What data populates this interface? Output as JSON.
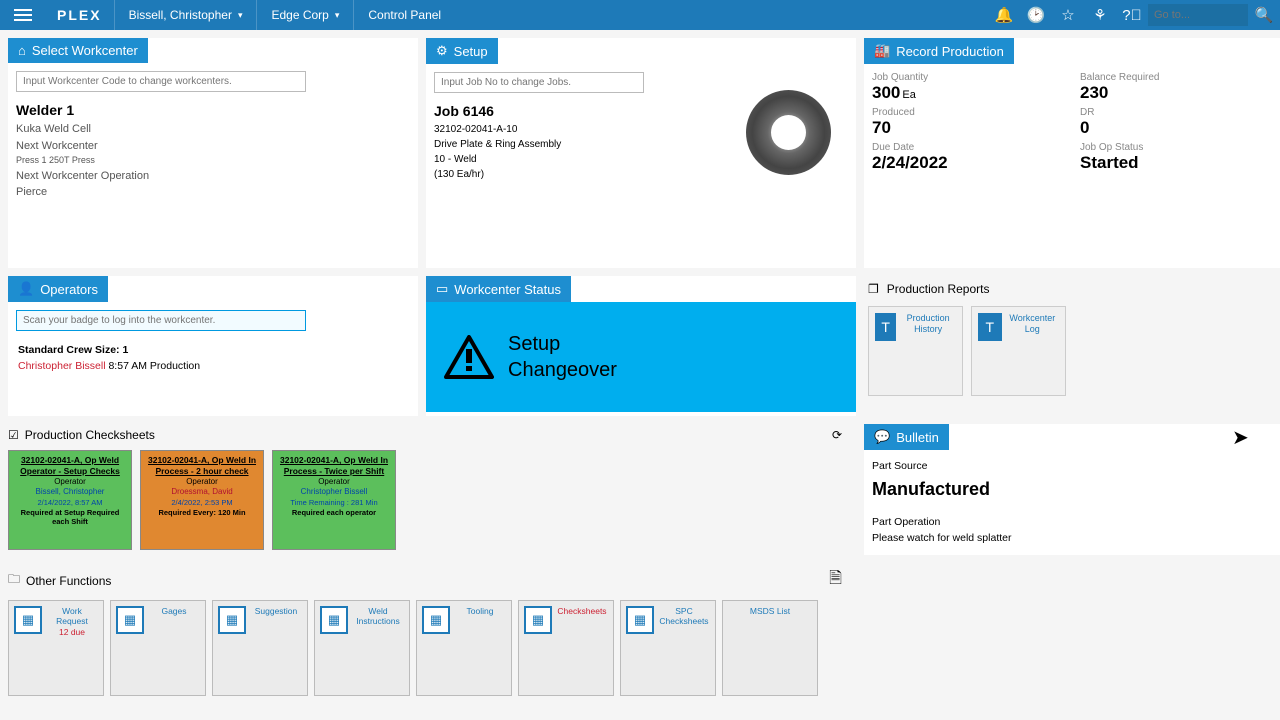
{
  "topbar": {
    "logo": "PLEX",
    "user": "Bissell, Christopher",
    "company": "Edge Corp",
    "page": "Control Panel",
    "goto_placeholder": "Go to..."
  },
  "workcenter": {
    "header": "Select Workcenter",
    "input_placeholder": "Input Workcenter Code to change workcenters.",
    "name": "Welder 1",
    "cell": "Kuka Weld Cell",
    "next_label": "Next Workcenter",
    "next_value": "Press 1 250T Press",
    "next_op_label": "Next Workcenter Operation",
    "next_op_value": "Pierce"
  },
  "setup": {
    "header": "Setup",
    "input_placeholder": "Input Job No to change Jobs.",
    "job_title": "Job 6146",
    "part_no": "32102-02041-A-10",
    "part_name": "Drive Plate & Ring Assembly",
    "op": "10 - Weld",
    "rate": "(130 Ea/hr)"
  },
  "production": {
    "header": "Record Production",
    "labels": {
      "qty": "Job Quantity",
      "balance": "Balance Required",
      "produced": "Produced",
      "dr": "DR",
      "due": "Due Date",
      "status": "Job Op Status"
    },
    "values": {
      "qty": "300",
      "qty_unit": "Ea",
      "balance": "230",
      "produced": "70",
      "dr": "0",
      "due": "2/24/2022",
      "status": "Started"
    }
  },
  "operators": {
    "header": "Operators",
    "input_placeholder": "Scan your badge to log into the workcenter.",
    "crew": "Standard Crew Size: 1",
    "name": "Christopher Bissell",
    "time": "8:57 AM Production"
  },
  "status": {
    "header": "Workcenter Status",
    "line1": "Setup",
    "line2": "Changeover"
  },
  "reports": {
    "header": "Production Reports",
    "tiles": [
      "Production History",
      "Workcenter Log"
    ]
  },
  "checksheets": {
    "header": "Production Checksheets",
    "items": [
      {
        "color": "cs-green",
        "title": "32102-02041-A, Op Weld Operator - Setup Checks",
        "role": "Operator",
        "name": "Bissell, Christopher",
        "time": "2/14/2022, 8:57 AM",
        "req": "Required at Setup Required each Shift"
      },
      {
        "color": "cs-orange",
        "title": "32102-02041-A, Op Weld In Process - 2 hour check",
        "role": "Operator",
        "name": "Droessma, David",
        "time": "2/4/2022, 2:53 PM",
        "req": "Required Every: 120 Min"
      },
      {
        "color": "cs-green",
        "title": "32102-02041-A, Op Weld In Process - Twice per Shift",
        "role": "Operator",
        "name": "Christopher Bissell",
        "time": "Time Remaining : 281 Min",
        "req": "Required each operator"
      }
    ]
  },
  "bulletin": {
    "header": "Bulletin",
    "source_label": "Part Source",
    "source": "Manufactured",
    "op_label": "Part Operation",
    "op_note": "Please watch for weld splatter"
  },
  "other": {
    "header": "Other Functions",
    "tiles": [
      {
        "label": "Work Request",
        "sub": "12 due"
      },
      {
        "label": "Gages"
      },
      {
        "label": "Suggestion"
      },
      {
        "label": "Weld Instructions"
      },
      {
        "label": "Tooling"
      },
      {
        "label": "Checksheets",
        "red": true
      },
      {
        "label": "SPC Checksheets"
      },
      {
        "label": "MSDS List",
        "noicon": true
      }
    ]
  }
}
